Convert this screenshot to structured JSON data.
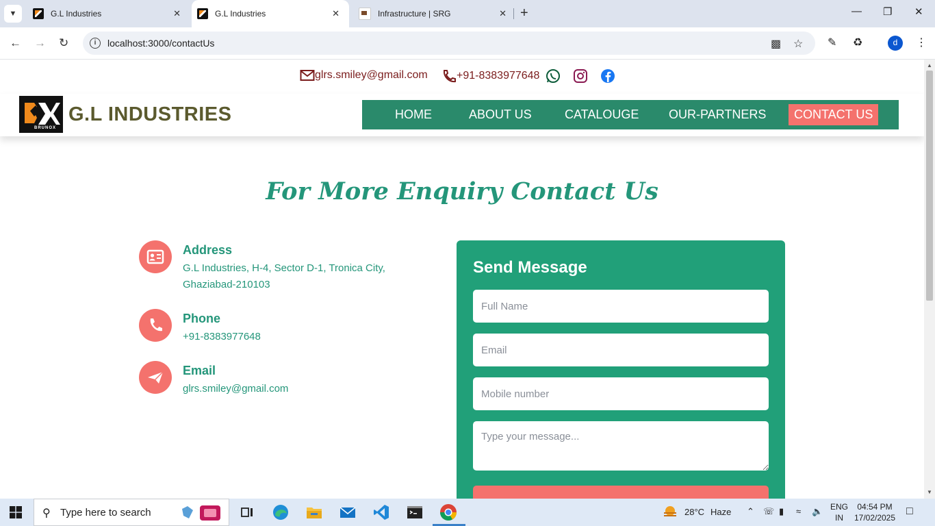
{
  "browser": {
    "tabs": [
      {
        "title": "G.L Industries"
      },
      {
        "title": "G.L Industries"
      },
      {
        "title": "Infrastructure | SRG"
      }
    ],
    "url": "localhost:3000/contactUs",
    "profile_initial": "d"
  },
  "topbar": {
    "email": "glrs.smiley@gmail.com",
    "phone": "+91-8383977648"
  },
  "header": {
    "brand": "G.L INDUSTRIES",
    "logo_text": "BRUNOX",
    "nav": [
      "HOME",
      "ABOUT US",
      "CATALOUGE",
      "OUR-PARTNERS",
      "CONTACT US"
    ],
    "active_nav": "CONTACT US"
  },
  "main": {
    "heading": "For More Enquiry Contact Us",
    "contact": [
      {
        "title": "Address",
        "value": "G.L Industries, H-4, Sector D-1, Tronica City, Ghaziabad-210103",
        "icon": "id-card-icon"
      },
      {
        "title": "Phone",
        "value": "+91-8383977648",
        "icon": "phone-icon"
      },
      {
        "title": "Email",
        "value": "glrs.smiley@gmail.com",
        "icon": "paper-plane-icon"
      }
    ],
    "form": {
      "title": "Send Message",
      "name_placeholder": "Full Name",
      "email_placeholder": "Email",
      "mobile_placeholder": "Mobile number",
      "message_placeholder": "Type your message..."
    }
  },
  "taskbar": {
    "search_placeholder": "Type here to search",
    "weather_temp": "28°C",
    "weather_desc": "Haze",
    "lang": "ENG",
    "region": "IN",
    "time": "04:54 PM",
    "date": "17/02/2025"
  },
  "colors": {
    "accent_green": "#24967a",
    "nav_green": "#2a8a6b",
    "coral": "#f4726d"
  }
}
